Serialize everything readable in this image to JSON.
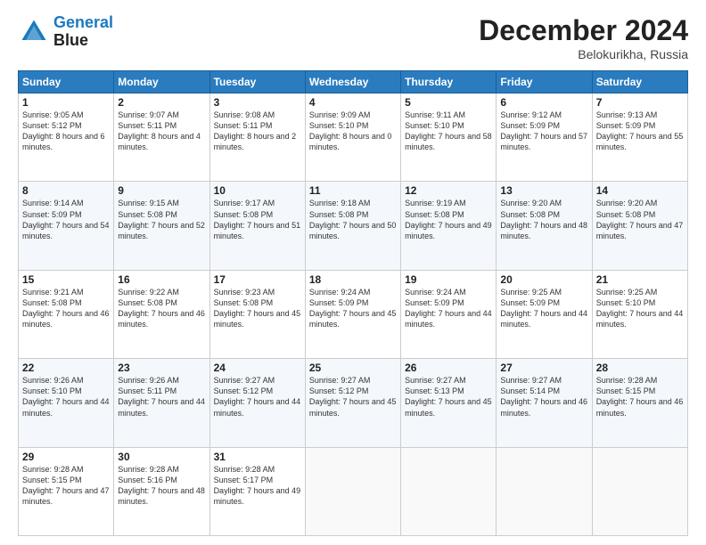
{
  "header": {
    "logo_line1": "General",
    "logo_line2": "Blue",
    "month": "December 2024",
    "location": "Belokurikha, Russia"
  },
  "days_of_week": [
    "Sunday",
    "Monday",
    "Tuesday",
    "Wednesday",
    "Thursday",
    "Friday",
    "Saturday"
  ],
  "weeks": [
    [
      {
        "day": "1",
        "sunrise": "Sunrise: 9:05 AM",
        "sunset": "Sunset: 5:12 PM",
        "daylight": "Daylight: 8 hours and 6 minutes."
      },
      {
        "day": "2",
        "sunrise": "Sunrise: 9:07 AM",
        "sunset": "Sunset: 5:11 PM",
        "daylight": "Daylight: 8 hours and 4 minutes."
      },
      {
        "day": "3",
        "sunrise": "Sunrise: 9:08 AM",
        "sunset": "Sunset: 5:11 PM",
        "daylight": "Daylight: 8 hours and 2 minutes."
      },
      {
        "day": "4",
        "sunrise": "Sunrise: 9:09 AM",
        "sunset": "Sunset: 5:10 PM",
        "daylight": "Daylight: 8 hours and 0 minutes."
      },
      {
        "day": "5",
        "sunrise": "Sunrise: 9:11 AM",
        "sunset": "Sunset: 5:10 PM",
        "daylight": "Daylight: 7 hours and 58 minutes."
      },
      {
        "day": "6",
        "sunrise": "Sunrise: 9:12 AM",
        "sunset": "Sunset: 5:09 PM",
        "daylight": "Daylight: 7 hours and 57 minutes."
      },
      {
        "day": "7",
        "sunrise": "Sunrise: 9:13 AM",
        "sunset": "Sunset: 5:09 PM",
        "daylight": "Daylight: 7 hours and 55 minutes."
      }
    ],
    [
      {
        "day": "8",
        "sunrise": "Sunrise: 9:14 AM",
        "sunset": "Sunset: 5:09 PM",
        "daylight": "Daylight: 7 hours and 54 minutes."
      },
      {
        "day": "9",
        "sunrise": "Sunrise: 9:15 AM",
        "sunset": "Sunset: 5:08 PM",
        "daylight": "Daylight: 7 hours and 52 minutes."
      },
      {
        "day": "10",
        "sunrise": "Sunrise: 9:17 AM",
        "sunset": "Sunset: 5:08 PM",
        "daylight": "Daylight: 7 hours and 51 minutes."
      },
      {
        "day": "11",
        "sunrise": "Sunrise: 9:18 AM",
        "sunset": "Sunset: 5:08 PM",
        "daylight": "Daylight: 7 hours and 50 minutes."
      },
      {
        "day": "12",
        "sunrise": "Sunrise: 9:19 AM",
        "sunset": "Sunset: 5:08 PM",
        "daylight": "Daylight: 7 hours and 49 minutes."
      },
      {
        "day": "13",
        "sunrise": "Sunrise: 9:20 AM",
        "sunset": "Sunset: 5:08 PM",
        "daylight": "Daylight: 7 hours and 48 minutes."
      },
      {
        "day": "14",
        "sunrise": "Sunrise: 9:20 AM",
        "sunset": "Sunset: 5:08 PM",
        "daylight": "Daylight: 7 hours and 47 minutes."
      }
    ],
    [
      {
        "day": "15",
        "sunrise": "Sunrise: 9:21 AM",
        "sunset": "Sunset: 5:08 PM",
        "daylight": "Daylight: 7 hours and 46 minutes."
      },
      {
        "day": "16",
        "sunrise": "Sunrise: 9:22 AM",
        "sunset": "Sunset: 5:08 PM",
        "daylight": "Daylight: 7 hours and 46 minutes."
      },
      {
        "day": "17",
        "sunrise": "Sunrise: 9:23 AM",
        "sunset": "Sunset: 5:08 PM",
        "daylight": "Daylight: 7 hours and 45 minutes."
      },
      {
        "day": "18",
        "sunrise": "Sunrise: 9:24 AM",
        "sunset": "Sunset: 5:09 PM",
        "daylight": "Daylight: 7 hours and 45 minutes."
      },
      {
        "day": "19",
        "sunrise": "Sunrise: 9:24 AM",
        "sunset": "Sunset: 5:09 PM",
        "daylight": "Daylight: 7 hours and 44 minutes."
      },
      {
        "day": "20",
        "sunrise": "Sunrise: 9:25 AM",
        "sunset": "Sunset: 5:09 PM",
        "daylight": "Daylight: 7 hours and 44 minutes."
      },
      {
        "day": "21",
        "sunrise": "Sunrise: 9:25 AM",
        "sunset": "Sunset: 5:10 PM",
        "daylight": "Daylight: 7 hours and 44 minutes."
      }
    ],
    [
      {
        "day": "22",
        "sunrise": "Sunrise: 9:26 AM",
        "sunset": "Sunset: 5:10 PM",
        "daylight": "Daylight: 7 hours and 44 minutes."
      },
      {
        "day": "23",
        "sunrise": "Sunrise: 9:26 AM",
        "sunset": "Sunset: 5:11 PM",
        "daylight": "Daylight: 7 hours and 44 minutes."
      },
      {
        "day": "24",
        "sunrise": "Sunrise: 9:27 AM",
        "sunset": "Sunset: 5:12 PM",
        "daylight": "Daylight: 7 hours and 44 minutes."
      },
      {
        "day": "25",
        "sunrise": "Sunrise: 9:27 AM",
        "sunset": "Sunset: 5:12 PM",
        "daylight": "Daylight: 7 hours and 45 minutes."
      },
      {
        "day": "26",
        "sunrise": "Sunrise: 9:27 AM",
        "sunset": "Sunset: 5:13 PM",
        "daylight": "Daylight: 7 hours and 45 minutes."
      },
      {
        "day": "27",
        "sunrise": "Sunrise: 9:27 AM",
        "sunset": "Sunset: 5:14 PM",
        "daylight": "Daylight: 7 hours and 46 minutes."
      },
      {
        "day": "28",
        "sunrise": "Sunrise: 9:28 AM",
        "sunset": "Sunset: 5:15 PM",
        "daylight": "Daylight: 7 hours and 46 minutes."
      }
    ],
    [
      {
        "day": "29",
        "sunrise": "Sunrise: 9:28 AM",
        "sunset": "Sunset: 5:15 PM",
        "daylight": "Daylight: 7 hours and 47 minutes."
      },
      {
        "day": "30",
        "sunrise": "Sunrise: 9:28 AM",
        "sunset": "Sunset: 5:16 PM",
        "daylight": "Daylight: 7 hours and 48 minutes."
      },
      {
        "day": "31",
        "sunrise": "Sunrise: 9:28 AM",
        "sunset": "Sunset: 5:17 PM",
        "daylight": "Daylight: 7 hours and 49 minutes."
      },
      null,
      null,
      null,
      null
    ]
  ]
}
